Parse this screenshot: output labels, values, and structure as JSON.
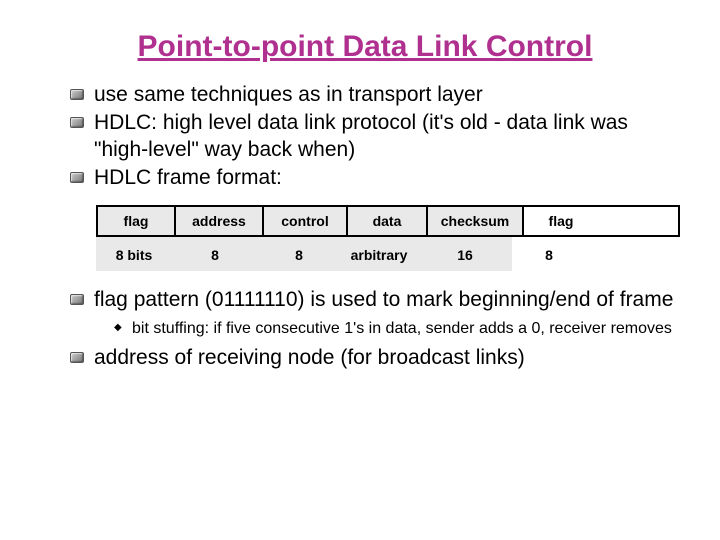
{
  "title": "Point-to-point Data Link Control",
  "bullets": {
    "b1": "use same techniques as in transport layer",
    "b2": "HDLC: high level data link protocol  (it's old - data link was \"high-level\" way back when)",
    "b3": "HDLC frame format:",
    "b4": "flag pattern (01111110) is used to mark beginning/end of frame",
    "b4_sub1": "bit stuffing: if five consecutive 1's in data, sender adds a 0, receiver removes",
    "b5": "address of receiving node (for broadcast links)"
  },
  "diagram": {
    "headers": [
      "flag",
      "address",
      "control",
      "data",
      "checksum",
      "flag"
    ],
    "values": [
      "8 bits",
      "8",
      "8",
      "arbitrary",
      "16",
      "8"
    ]
  }
}
